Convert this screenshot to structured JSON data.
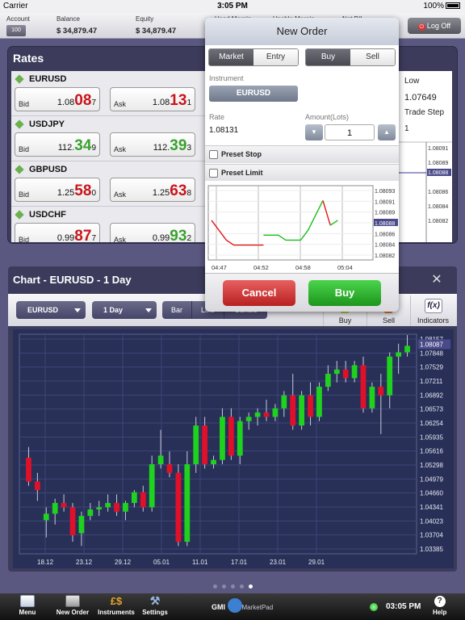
{
  "status_bar": {
    "carrier": "Carrier",
    "time": "3:05 PM",
    "battery": "100%"
  },
  "account_bar": {
    "account_label": "Account",
    "account_button": "100",
    "balance_label": "Balance",
    "balance_value": "$ 34,879.47",
    "equity_label": "Equity",
    "equity_value": "$ 34,879.47",
    "used_margin_label": "Used Margin",
    "usable_margin_label": "Usable Margin",
    "net_pl_label": "Net P/L",
    "logoff_label": "Log Off"
  },
  "rates": {
    "title": "Rates",
    "rows": [
      {
        "symbol": "EURUSD",
        "bid_label": "Bid",
        "bid_pre": "1.08",
        "bid_big": "08",
        "bid_small": "7",
        "bid_color": "red",
        "ask_label": "Ask",
        "ask_pre": "1.08",
        "ask_big": "13",
        "ask_small": "1",
        "ask_color": "red"
      },
      {
        "symbol": "USDJPY",
        "bid_label": "Bid",
        "bid_pre": "112.",
        "bid_big": "34",
        "bid_small": "9",
        "bid_color": "grn",
        "ask_label": "Ask",
        "ask_pre": "112.",
        "ask_big": "39",
        "ask_small": "3",
        "ask_color": "grn"
      },
      {
        "symbol": "GBPUSD",
        "bid_label": "Bid",
        "bid_pre": "1.25",
        "bid_big": "58",
        "bid_small": "0",
        "bid_color": "red",
        "ask_label": "Ask",
        "ask_pre": "1.25",
        "ask_big": "63",
        "ask_small": "8",
        "ask_color": "red"
      },
      {
        "symbol": "USDCHF",
        "bid_label": "Bid",
        "bid_pre": "0.99",
        "bid_big": "87",
        "bid_small": "7",
        "bid_color": "red",
        "ask_label": "Ask",
        "ask_pre": "0.99",
        "ask_big": "93",
        "ask_small": "2",
        "ask_color": "grn"
      }
    ],
    "side": {
      "low_label": "Low",
      "low_value": "1.07649",
      "trade_step_label": "Trade Step",
      "trade_step_value": "1",
      "ticks": [
        "1.08091",
        "1.08089",
        "1.08088",
        "1.08086",
        "1.08084",
        "1.08082"
      ]
    }
  },
  "new_order": {
    "title": "New Order",
    "type_tabs": [
      "Market",
      "Entry"
    ],
    "type_selected": 0,
    "side_tabs": [
      "Buy",
      "Sell"
    ],
    "side_selected": 0,
    "instrument_label": "Instrument",
    "instrument_value": "EURUSD",
    "rate_label": "Rate",
    "rate_value": "1.08131",
    "amount_label": "Amount(Lots)",
    "amount_value": "1",
    "preset_stop_label": "Preset Stop",
    "preset_limit_label": "Preset Limit",
    "cancel_label": "Cancel",
    "buy_label": "Buy",
    "mini_chart": {
      "x_ticks": [
        "04:47",
        "04:52",
        "04:58",
        "05:04"
      ],
      "y_ticks": [
        "1.08093",
        "1.08091",
        "1.08089",
        "1.08088",
        "1.08086",
        "1.08084",
        "1.08082"
      ],
      "current": "1.08088"
    }
  },
  "chart_panel": {
    "title": "Chart - EURUSD - 1 Day",
    "close_icon": "close-icon",
    "instrument_select": "EURUSD",
    "period_select": "1 Day",
    "chart_types": [
      "Bar",
      "Line",
      "Candle"
    ],
    "chart_type_selected": 2,
    "buy_label": "Buy",
    "sell_label": "Sell",
    "indicators_label": "Indicators"
  },
  "chart_data": [
    {
      "type": "candlestick",
      "title": "",
      "current": "1.08087",
      "x_tick_labels": [
        "18.12",
        "23.12",
        "29.12",
        "05.01",
        "11.01",
        "17.01",
        "23.01",
        "29.01"
      ],
      "y_tick_labels": [
        "1.08157",
        "1.07848",
        "1.07529",
        "1.07211",
        "1.06892",
        "1.06573",
        "1.06254",
        "1.05935",
        "1.05616",
        "1.05298",
        "1.04979",
        "1.04660",
        "1.04341",
        "1.04023",
        "1.03704",
        "1.03385"
      ],
      "ylim": [
        1.0322,
        1.0832
      ],
      "up_color": "#1ed21e",
      "down_color": "#e0102a",
      "candles": [
        [
          1.0545,
          1.057,
          1.048,
          1.049
        ],
        [
          1.049,
          1.051,
          1.0445,
          1.047
        ],
        [
          1.04,
          1.043,
          1.036,
          1.0415
        ],
        [
          1.0415,
          1.045,
          1.039,
          1.044
        ],
        [
          1.044,
          1.046,
          1.042,
          1.043
        ],
        [
          1.043,
          1.044,
          1.035,
          1.0365
        ],
        [
          1.037,
          1.042,
          1.034,
          1.041
        ],
        [
          1.041,
          1.044,
          1.04,
          1.0425
        ],
        [
          1.0425,
          1.0445,
          1.041,
          1.043
        ],
        [
          1.043,
          1.046,
          1.042,
          1.044
        ],
        [
          1.044,
          1.046,
          1.041,
          1.042
        ],
        [
          1.042,
          1.0445,
          1.04,
          1.044
        ],
        [
          1.044,
          1.047,
          1.043,
          1.0465
        ],
        [
          1.0465,
          1.048,
          1.042,
          1.043
        ],
        [
          1.043,
          1.055,
          1.042,
          1.053
        ],
        [
          1.053,
          1.061,
          1.052,
          1.055
        ],
        [
          1.053,
          1.056,
          1.05,
          1.051
        ],
        [
          1.051,
          1.053,
          1.034,
          1.035
        ],
        [
          1.035,
          1.056,
          1.034,
          1.053
        ],
        [
          1.053,
          1.064,
          1.051,
          1.062
        ],
        [
          1.062,
          1.064,
          1.052,
          1.053
        ],
        [
          1.053,
          1.055,
          1.052,
          1.054
        ],
        [
          1.054,
          1.066,
          1.053,
          1.064
        ],
        [
          1.064,
          1.066,
          1.054,
          1.055
        ],
        [
          1.055,
          1.064,
          1.053,
          1.063
        ],
        [
          1.063,
          1.065,
          1.061,
          1.064
        ],
        [
          1.064,
          1.066,
          1.062,
          1.065
        ],
        [
          1.065,
          1.068,
          1.063,
          1.064
        ],
        [
          1.064,
          1.067,
          1.063,
          1.066
        ],
        [
          1.066,
          1.07,
          1.064,
          1.069
        ],
        [
          1.069,
          1.074,
          1.061,
          1.062
        ],
        [
          1.062,
          1.07,
          1.061,
          1.069
        ],
        [
          1.069,
          1.072,
          1.062,
          1.064
        ],
        [
          1.064,
          1.072,
          1.063,
          1.071
        ],
        [
          1.071,
          1.076,
          1.07,
          1.074
        ],
        [
          1.074,
          1.077,
          1.072,
          1.075
        ],
        [
          1.075,
          1.077,
          1.072,
          1.073
        ],
        [
          1.073,
          1.077,
          1.072,
          1.076
        ],
        [
          1.076,
          1.078,
          1.065,
          1.066
        ],
        [
          1.066,
          1.072,
          1.065,
          1.071
        ],
        [
          1.071,
          1.074,
          1.06,
          1.069
        ],
        [
          1.069,
          1.079,
          1.066,
          1.078
        ],
        [
          1.078,
          1.081,
          1.074,
          1.079
        ],
        [
          1.079,
          1.083,
          1.078,
          1.0805
        ]
      ]
    },
    {
      "type": "line",
      "title": "",
      "x_tick_labels": [
        "04:47",
        "04:52",
        "04:58",
        "05:04"
      ],
      "y_tick_labels": [
        "1.08093",
        "1.08091",
        "1.08089",
        "1.08088",
        "1.08086",
        "1.08084",
        "1.08082"
      ],
      "ylim": [
        1.0808,
        1.08095
      ],
      "series": [
        {
          "color": "#e01818",
          "values": [
            1.08088,
            1.08086,
            1.08084,
            1.08083,
            1.08083,
            1.08083,
            1.08083,
            1.08083
          ]
        },
        {
          "color": "#18c018",
          "values": [
            1.08085,
            1.08085,
            1.08085,
            1.08084,
            1.08084,
            1.08084,
            1.08086,
            1.08089,
            1.08092
          ]
        },
        {
          "color": "#e01818",
          "values": [
            1.08092,
            1.08087
          ]
        },
        {
          "color": "#18c018",
          "values": [
            1.08087,
            1.08088
          ]
        }
      ]
    }
  ],
  "page_dots": {
    "count": 5,
    "active": 4
  },
  "bottom_bar": {
    "items": [
      {
        "label": "Menu",
        "icon": "menu-icon"
      },
      {
        "label": "New Order",
        "icon": "new-order-icon"
      },
      {
        "label": "Instruments",
        "icon": "instruments-icon"
      },
      {
        "label": "Settings",
        "icon": "settings-icon"
      }
    ],
    "brand": "GMI",
    "brand_sub": "MarketPad",
    "clock": "03:05 PM",
    "help_label": "Help"
  }
}
